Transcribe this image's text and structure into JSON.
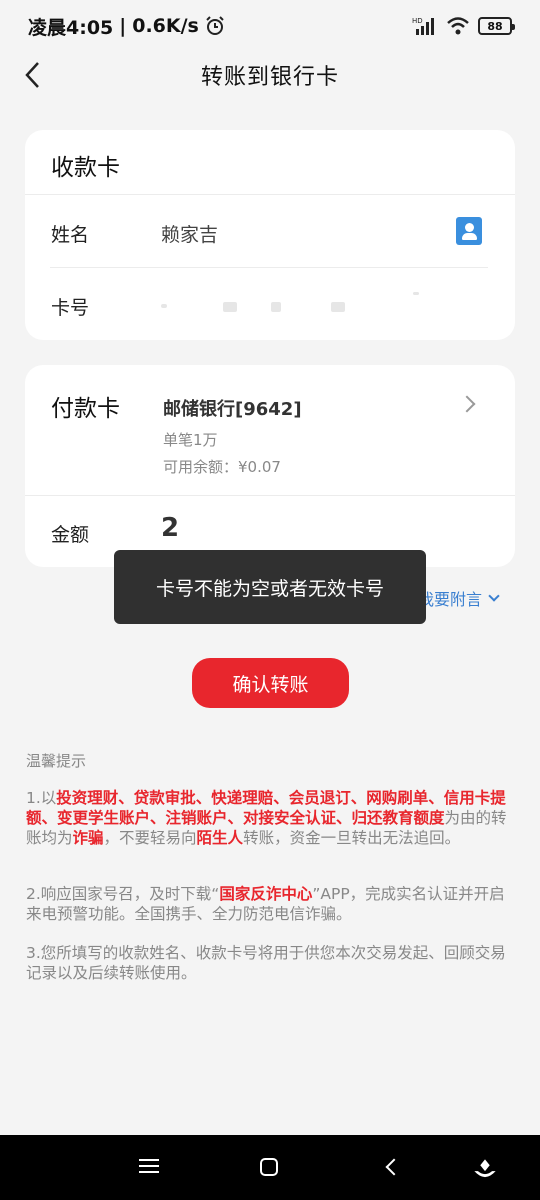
{
  "status_bar": {
    "time": "凌晨4:05",
    "separator": "|",
    "net_speed": "0.6K/s",
    "alarm_icon": "alarm-icon",
    "signal_badge": "HD",
    "battery": "88"
  },
  "nav": {
    "title": "转账到银行卡",
    "back_icon": "back-arrow-icon"
  },
  "receiver_card": {
    "heading": "收款卡",
    "name_label": "姓名",
    "name_value": "赖家吉",
    "contact_icon": "contact-book-icon",
    "card_label": "卡号",
    "card_value": ""
  },
  "payer_card": {
    "heading": "付款卡",
    "bank": "邮储银行[9642]",
    "limit": "单笔1万",
    "balance": "可用余额：¥0.07",
    "amount_label": "金额",
    "amount_value": "2"
  },
  "toast": {
    "message": "卡号不能为空或者无效卡号"
  },
  "memo_link": {
    "label": "我要附言"
  },
  "confirm_button": {
    "label": "确认转账"
  },
  "tips": {
    "title": "温馨提示",
    "tip1_prefix": "1.以",
    "tip1_highlight": "投资理财、贷款审批、快递理赔、会员退订、网购刷单、信用卡提额、变更学生账户、注销账户、对接安全认证、归还教育额度",
    "tip1_mid1": "为由的转账均为",
    "tip1_fraud": "诈骗",
    "tip1_mid2": "，不要轻易向",
    "tip1_stranger": "陌生人",
    "tip1_suffix": "转账，资金一旦转出无法追回。",
    "tip2_prefix": "2.响应国家号召，及时下载“",
    "tip2_highlight": "国家反诈中心",
    "tip2_suffix": "”APP，完成实名认证并开启来电预警功能。全国携手、全力防范电信诈骗。",
    "tip3": "3.您所填写的收款姓名、收款卡号将用于供您本次交易发起、回顾交易记录以及后续转账使用。"
  },
  "system_nav": {
    "menu_icon": "menu-icon",
    "home_icon": "home-icon",
    "back_icon": "back-icon",
    "assist_icon": "assistant-icon"
  },
  "colors": {
    "accent_red": "#e8262d",
    "link_blue": "#3a7fd0",
    "contact_blue": "#3a8fde"
  }
}
